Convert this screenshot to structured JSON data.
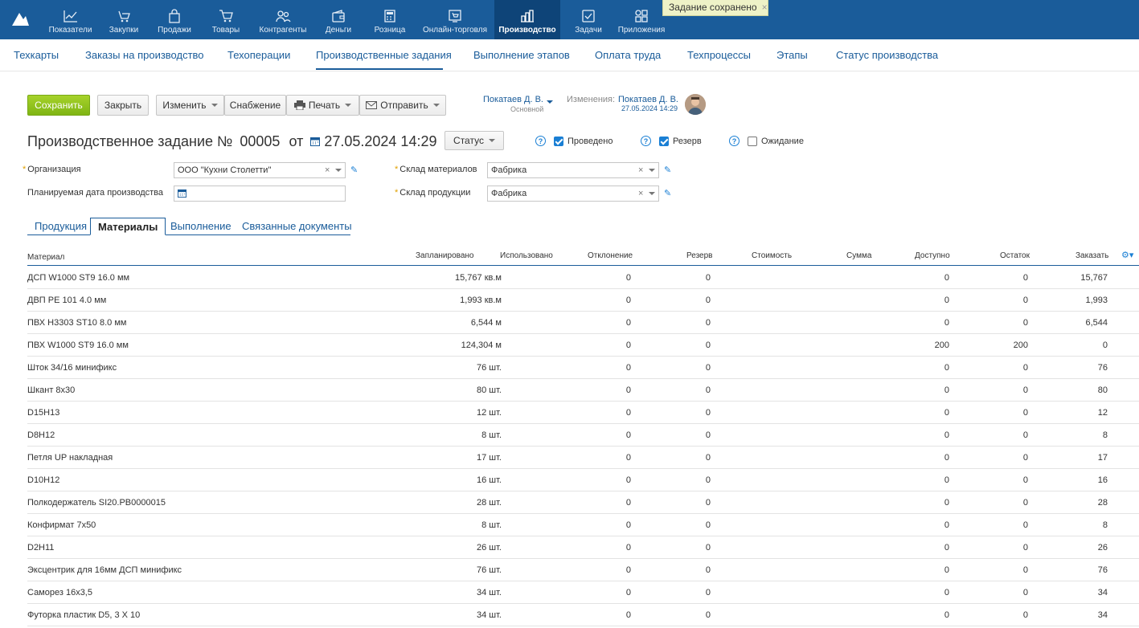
{
  "topnav": {
    "items": [
      {
        "label": "Показатели",
        "icon": "chart-line-icon"
      },
      {
        "label": "Закупки",
        "icon": "cart-hand-icon"
      },
      {
        "label": "Продажи",
        "icon": "bag-icon"
      },
      {
        "label": "Товары",
        "icon": "cart-icon"
      },
      {
        "label": "Контрагенты",
        "icon": "people-icon"
      },
      {
        "label": "Деньги",
        "icon": "wallet-icon"
      },
      {
        "label": "Розница",
        "icon": "register-icon"
      },
      {
        "label": "Онлайн-торговля",
        "icon": "online-store-icon"
      },
      {
        "label": "Производство",
        "icon": "factory-icon"
      },
      {
        "label": "Задачи",
        "icon": "checkbox-icon"
      },
      {
        "label": "Приложения",
        "icon": "apps-icon"
      }
    ],
    "active": "Производство"
  },
  "toast": {
    "text": "Задание сохранено",
    "close": "×"
  },
  "subnav": {
    "items": [
      "Техкарты",
      "Заказы на производство",
      "Техоперации",
      "Производственные задания",
      "Выполнение этапов",
      "Оплата труда",
      "Техпроцессы",
      "Этапы",
      "Статус производства"
    ],
    "active": "Производственные задания"
  },
  "toolbar": {
    "save": "Сохранить",
    "close": "Закрыть",
    "edit": "Изменить",
    "supply": "Снабжение",
    "print": "Печать",
    "send": "Отправить"
  },
  "owner": {
    "name": "Покатаев Д. В.",
    "group": "Основной"
  },
  "changes": {
    "label": "Изменения:",
    "name": "Покатаев Д. В.",
    "date": "27.05.2024 14:29"
  },
  "doc": {
    "title": "Производственное задание №",
    "number": "00005",
    "from": "от",
    "date": "27.05.2024 14:29",
    "status_label": "Статус",
    "flags": [
      {
        "label": "Проведено",
        "checked": true
      },
      {
        "label": "Резерв",
        "checked": true
      },
      {
        "label": "Ожидание",
        "checked": false
      }
    ]
  },
  "form": {
    "org_label": "Организация",
    "org_value": "ООО \"Кухни Столетти\"",
    "plan_date_label": "Планируемая дата производства",
    "plan_date_value": "",
    "mat_store_label": "Склад материалов",
    "mat_store_value": "Фабрика",
    "prod_store_label": "Склад продукции",
    "prod_store_value": "Фабрика"
  },
  "tabs": [
    "Продукция",
    "Материалы",
    "Выполнение",
    "Связанные документы"
  ],
  "active_tab": "Материалы",
  "table": {
    "columns": [
      "Материал",
      "Запланировано",
      "Использовано",
      "Отклонение",
      "Резерв",
      "Стоимость",
      "Сумма",
      "Доступно",
      "Остаток",
      "Заказать"
    ],
    "rows": [
      {
        "name": "ДСП W1000 ST9 16.0 мм",
        "planned": "15,767 кв.м",
        "used": "",
        "dev": "0",
        "reserve": "0",
        "cost": "",
        "sum": "",
        "avail": "0",
        "rest": "0",
        "order": "15,767"
      },
      {
        "name": "ДВП PE 101 4.0 мм",
        "planned": "1,993 кв.м",
        "used": "",
        "dev": "0",
        "reserve": "0",
        "cost": "",
        "sum": "",
        "avail": "0",
        "rest": "0",
        "order": "1,993"
      },
      {
        "name": "ПВХ H3303 ST10 8.0 мм",
        "planned": "6,544 м",
        "used": "",
        "dev": "0",
        "reserve": "0",
        "cost": "",
        "sum": "",
        "avail": "0",
        "rest": "0",
        "order": "6,544"
      },
      {
        "name": "ПВХ W1000 ST9 16.0 мм",
        "planned": "124,304 м",
        "used": "",
        "dev": "0",
        "reserve": "0",
        "cost": "",
        "sum": "",
        "avail": "200",
        "rest": "200",
        "order": "0"
      },
      {
        "name": "Шток 34/16 минификс",
        "planned": "76 шт.",
        "used": "",
        "dev": "0",
        "reserve": "0",
        "cost": "",
        "sum": "",
        "avail": "0",
        "rest": "0",
        "order": "76"
      },
      {
        "name": "Шкант 8х30",
        "planned": "80 шт.",
        "used": "",
        "dev": "0",
        "reserve": "0",
        "cost": "",
        "sum": "",
        "avail": "0",
        "rest": "0",
        "order": "80"
      },
      {
        "name": "D15H13",
        "planned": "12 шт.",
        "used": "",
        "dev": "0",
        "reserve": "0",
        "cost": "",
        "sum": "",
        "avail": "0",
        "rest": "0",
        "order": "12"
      },
      {
        "name": "D8H12",
        "planned": "8 шт.",
        "used": "",
        "dev": "0",
        "reserve": "0",
        "cost": "",
        "sum": "",
        "avail": "0",
        "rest": "0",
        "order": "8"
      },
      {
        "name": "Петля UP накладная",
        "planned": "17 шт.",
        "used": "",
        "dev": "0",
        "reserve": "0",
        "cost": "",
        "sum": "",
        "avail": "0",
        "rest": "0",
        "order": "17"
      },
      {
        "name": "D10H12",
        "planned": "16 шт.",
        "used": "",
        "dev": "0",
        "reserve": "0",
        "cost": "",
        "sum": "",
        "avail": "0",
        "rest": "0",
        "order": "16"
      },
      {
        "name": "Полкодержатель SI20.PB0000015",
        "planned": "28 шт.",
        "used": "",
        "dev": "0",
        "reserve": "0",
        "cost": "",
        "sum": "",
        "avail": "0",
        "rest": "0",
        "order": "28"
      },
      {
        "name": "Конфирмат 7х50",
        "planned": "8 шт.",
        "used": "",
        "dev": "0",
        "reserve": "0",
        "cost": "",
        "sum": "",
        "avail": "0",
        "rest": "0",
        "order": "8"
      },
      {
        "name": "D2H11",
        "planned": "26 шт.",
        "used": "",
        "dev": "0",
        "reserve": "0",
        "cost": "",
        "sum": "",
        "avail": "0",
        "rest": "0",
        "order": "26"
      },
      {
        "name": "Эксцентрик для 16мм ДСП минификс",
        "planned": "76 шт.",
        "used": "",
        "dev": "0",
        "reserve": "0",
        "cost": "",
        "sum": "",
        "avail": "0",
        "rest": "0",
        "order": "76"
      },
      {
        "name": "Саморез 16х3,5",
        "planned": "34 шт.",
        "used": "",
        "dev": "0",
        "reserve": "0",
        "cost": "",
        "sum": "",
        "avail": "0",
        "rest": "0",
        "order": "34"
      },
      {
        "name": "Футорка пластик D5, 3 X 10",
        "planned": "34 шт.",
        "used": "",
        "dev": "0",
        "reserve": "0",
        "cost": "",
        "sum": "",
        "avail": "0",
        "rest": "0",
        "order": "34"
      }
    ]
  }
}
